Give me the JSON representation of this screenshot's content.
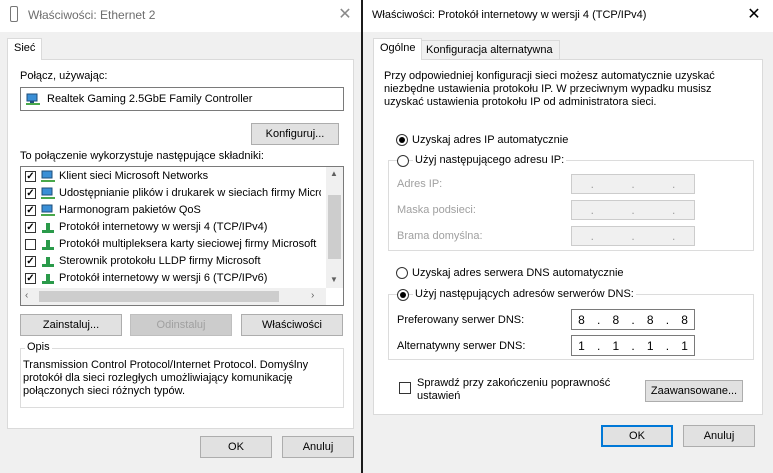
{
  "left": {
    "title": "Właściwości: Ethernet 2",
    "tab": "Sieć",
    "connect_label": "Połącz, używając:",
    "adapter": "Realtek Gaming 2.5GbE Family Controller",
    "configure_btn": "Konfiguruj...",
    "components_label": "To połączenie wykorzystuje następujące składniki:",
    "components": [
      {
        "label": "Klient sieci Microsoft Networks",
        "checked": true
      },
      {
        "label": "Udostępnianie plików i drukarek w sieciach firmy Micro",
        "checked": true
      },
      {
        "label": "Harmonogram pakietów QoS",
        "checked": true
      },
      {
        "label": "Protokół internetowy w wersji 4 (TCP/IPv4)",
        "checked": true
      },
      {
        "label": "Protokół multipleksera karty sieciowej firmy Microsoft",
        "checked": false
      },
      {
        "label": "Sterownik protokołu LLDP firmy Microsoft",
        "checked": true
      },
      {
        "label": "Protokół internetowy w wersji 6 (TCP/IPv6)",
        "checked": true
      }
    ],
    "install_btn": "Zainstaluj...",
    "uninstall_btn": "Odinstaluj",
    "properties_btn": "Właściwości",
    "desc_title": "Opis",
    "description": "Transmission Control Protocol/Internet Protocol. Domyślny protokół dla sieci rozległych umożliwiający komunikację połączonych sieci różnych typów.",
    "ok_btn": "OK",
    "cancel_btn": "Anuluj"
  },
  "right": {
    "title": "Właściwości: Protokół internetowy w wersji 4 (TCP/IPv4)",
    "tabs": [
      "Ogólne",
      "Konfiguracja alternatywna"
    ],
    "info": "Przy odpowiedniej konfiguracji sieci możesz automatycznie uzyskać niezbędne ustawienia protokołu IP. W przeciwnym wypadku musisz uzyskać ustawienia protokołu IP od administratora sieci.",
    "ip_auto": "Uzyskaj adres IP automatycznie",
    "ip_manual": "Użyj następującego adresu IP:",
    "ip_label": "Adres IP:",
    "mask_label": "Maska podsieci:",
    "gateway_label": "Brama domyślna:",
    "dns_auto": "Uzyskaj adres serwera DNS automatycznie",
    "dns_manual": "Użyj następujących adresów serwerów DNS:",
    "dns_pref_label": "Preferowany serwer DNS:",
    "dns_alt_label": "Alternatywny serwer DNS:",
    "dns_pref": [
      "8",
      "8",
      "8",
      "8"
    ],
    "dns_alt": [
      "1",
      "1",
      "1",
      "1"
    ],
    "validate": "Sprawdź przy zakończeniu poprawność ustawień",
    "advanced_btn": "Zaawansowane...",
    "ok_btn": "OK",
    "cancel_btn": "Anuluj"
  },
  "icons": {
    "close": "close-icon",
    "network": "network-adapter-icon",
    "chevron": "chevron-icon"
  }
}
